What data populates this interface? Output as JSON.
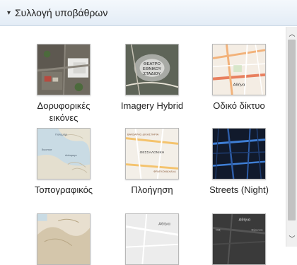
{
  "header": {
    "caret": "▾",
    "title": "Συλλογή υποβάθρων"
  },
  "gallery": {
    "items": [
      {
        "label": "Δορυφορικές εικόνες",
        "icon": "satellite-thumbnail"
      },
      {
        "label": "Imagery Hybrid",
        "icon": "imagery-hybrid-thumbnail",
        "thumb_text": [
          "ΘΕΑΤΡΟ",
          "ΕΘΝΙΚΟΥ",
          "ΣΤΑΔΙΟΥ"
        ]
      },
      {
        "label": "Οδικό δίκτυο",
        "icon": "streets-thumbnail",
        "thumb_text": [
          "Αθήνα"
        ]
      },
      {
        "label": "Τοπογραφικός",
        "icon": "topographic-thumbnail",
        "thumb_text": [
          "Παλαμάρι",
          "Άνιοποσ",
          "Δαλαμαρι"
        ]
      },
      {
        "label": "Πλοήγηση",
        "icon": "navigation-thumbnail",
        "thumb_text": [
          "ΒΑΡΔΑΡΗΣ-ΔΙΚΑΣΤΗΡΙΑ",
          "ΘΕΣΣΑΛΟΝΙΚΗ",
          "ΦΡΑΓΚΟΜΑΧΑΛΑ"
        ]
      },
      {
        "label": "Streets (Night)",
        "icon": "streets-night-thumbnail"
      },
      {
        "label": "",
        "icon": "terrain-thumbnail"
      },
      {
        "label": "",
        "icon": "light-gray-thumbnail",
        "thumb_text": [
          "Αθήνα"
        ]
      },
      {
        "label": "",
        "icon": "dark-gray-thumbnail",
        "thumb_text": [
          "Αθήνα",
          "Βύρωνας",
          "Ναξ"
        ]
      }
    ]
  },
  "colors": {
    "header_bg": "#e3ecf6",
    "scrollbar_thumb": "#c2c2c2"
  }
}
